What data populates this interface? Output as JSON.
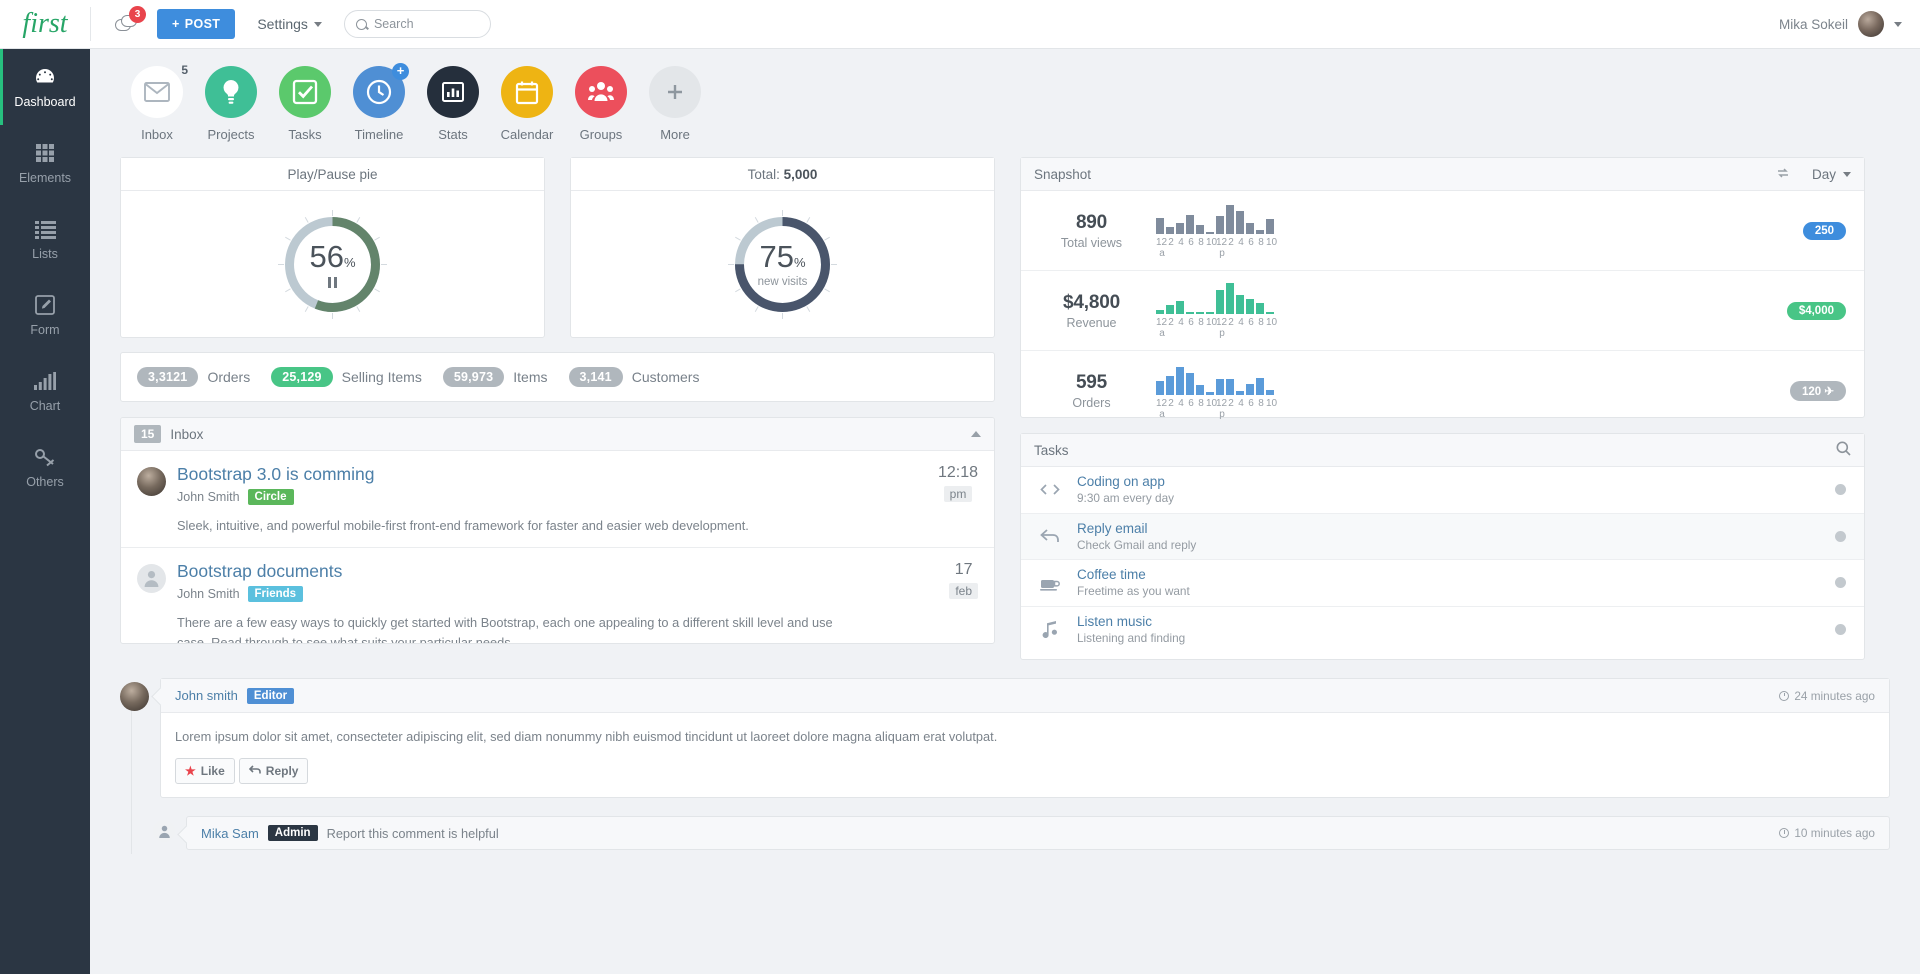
{
  "topbar": {
    "logo": "first",
    "chat_badge": "3",
    "post_label": "POST",
    "settings_label": "Settings",
    "search_placeholder": "Search",
    "search_value": "",
    "user_name": "Mika Sokeil"
  },
  "sidebar": {
    "items": [
      {
        "label": "Dashboard",
        "icon": "dashboard-gauge-icon",
        "active": true
      },
      {
        "label": "Elements",
        "icon": "grid-icon",
        "active": false
      },
      {
        "label": "Lists",
        "icon": "list-icon",
        "active": false
      },
      {
        "label": "Form",
        "icon": "pencil-square-icon",
        "active": false
      },
      {
        "label": "Chart",
        "icon": "bar-chart-icon",
        "active": false
      },
      {
        "label": "Others",
        "icon": "link-icon",
        "active": false
      }
    ]
  },
  "quick_icons": [
    {
      "label": "Inbox",
      "icon": "envelope-icon",
      "color": "#ffffff",
      "badge": "5"
    },
    {
      "label": "Projects",
      "icon": "lightbulb-icon",
      "color": "#3fbf96"
    },
    {
      "label": "Tasks",
      "icon": "check-square-icon",
      "color": "#5bc96c"
    },
    {
      "label": "Timeline",
      "icon": "clock-icon",
      "color": "#4f8fd4",
      "plus": "+"
    },
    {
      "label": "Stats",
      "icon": "chart-bars-icon",
      "color": "#252f3c"
    },
    {
      "label": "Calendar",
      "icon": "calendar-icon",
      "color": "#eeb413"
    },
    {
      "label": "Groups",
      "icon": "users-icon",
      "color": "#ec4f5c"
    },
    {
      "label": "More",
      "icon": "plus-icon",
      "color": "#e3e6e9"
    }
  ],
  "cards": {
    "playpause": {
      "title": "Play/Pause pie",
      "value": "56",
      "unit": "%",
      "icon": "pause-icon"
    },
    "total": {
      "title_prefix": "Total:",
      "title_value": "5,000",
      "value": "75",
      "unit": "%",
      "sublabel": "new visits"
    }
  },
  "stats_strip": [
    {
      "value": "3,3121",
      "label": "Orders",
      "color": "#b0b7bd"
    },
    {
      "value": "25,129",
      "label": "Selling Items",
      "color": "#48c586"
    },
    {
      "value": "59,973",
      "label": "Items",
      "color": "#b0b7bd"
    },
    {
      "value": "3,141",
      "label": "Customers",
      "color": "#b0b7bd"
    }
  ],
  "snapshot": {
    "title": "Snapshot",
    "refresh_icon": "refresh-icon",
    "range_label": "Day",
    "rows": [
      {
        "value": "890",
        "label": "Total views",
        "badge": "250",
        "badge_color": "#3e8ddd",
        "badge_icon": ""
      },
      {
        "value": "$4,800",
        "label": "Revenue",
        "badge": "$4,000",
        "badge_color": "#48c586",
        "badge_icon": ""
      },
      {
        "value": "595",
        "label": "Orders",
        "badge": "120",
        "badge_color": "#b0b7bd",
        "badge_icon": "✈"
      }
    ]
  },
  "chart_data": [
    {
      "type": "bar",
      "title": "Total views",
      "categories": [
        "12a",
        "2",
        "4",
        "6",
        "8",
        "10",
        "12p",
        "2",
        "4",
        "6",
        "8",
        "10"
      ],
      "values": [
        16,
        7,
        11,
        19,
        9,
        2,
        18,
        29,
        23,
        11,
        4,
        15
      ],
      "color": "#7f8b9c",
      "ylim": [
        0,
        32
      ],
      "xlabel": "",
      "ylabel": ""
    },
    {
      "type": "bar",
      "title": "Revenue",
      "categories": [
        "12a",
        "2",
        "4",
        "6",
        "8",
        "10",
        "12p",
        "2",
        "4",
        "6",
        "8",
        "10"
      ],
      "values": [
        4,
        9,
        13,
        2,
        2,
        2,
        24,
        31,
        19,
        15,
        11,
        2
      ],
      "color": "#3fbf96",
      "ylim": [
        0,
        32
      ],
      "xlabel": "",
      "ylabel": ""
    },
    {
      "type": "bar",
      "title": "Orders",
      "categories": [
        "12a",
        "2",
        "4",
        "6",
        "8",
        "10",
        "12p",
        "2",
        "4",
        "6",
        "8",
        "10"
      ],
      "values": [
        14,
        19,
        28,
        22,
        10,
        3,
        16,
        16,
        4,
        11,
        17,
        5
      ],
      "color": "#5b9bd9",
      "ylim": [
        0,
        32
      ],
      "xlabel": "",
      "ylabel": ""
    }
  ],
  "inbox": {
    "title": "Inbox",
    "count": "15",
    "messages": [
      {
        "title": "Bootstrap 3.0 is comming",
        "author": "John Smith",
        "tag": "Circle",
        "tag_color": "#5bb75b",
        "text": "Sleek, intuitive, and powerful mobile-first front-end framework for faster and easier web development.",
        "date_main": "12:18",
        "date_sub": "pm",
        "avatar": "photo"
      },
      {
        "title": "Bootstrap documents",
        "author": "John Smith",
        "tag": "Friends",
        "tag_color": "#5bc0de",
        "text": "There are a few easy ways to quickly get started with Bootstrap, each one appealing to a different skill level and use case. Read through to see what suits your particular needs.",
        "date_main": "17",
        "date_sub": "feb",
        "avatar": "placeholder"
      }
    ]
  },
  "tasks": {
    "title": "Tasks",
    "search_icon": "search-icon",
    "items": [
      {
        "title": "Coding on app",
        "sub": "9:30 am every day",
        "icon": "code-icon"
      },
      {
        "title": "Reply email",
        "sub": "Check Gmail and reply",
        "icon": "reply-icon"
      },
      {
        "title": "Coffee time",
        "sub": "Freetime as you want",
        "icon": "coffee-icon"
      },
      {
        "title": "Listen music",
        "sub": "Listening and finding",
        "icon": "music-icon"
      }
    ]
  },
  "comments": [
    {
      "name": "John smith",
      "tag": "Editor",
      "tag_color": "#4f8fd4",
      "time": "24 minutes ago",
      "body": "Lorem ipsum dolor sit amet, consecteter adipiscing elit, sed diam nonummy nibh euismod tincidunt ut laoreet dolore magna aliquam erat volutpat.",
      "like_label": "Like",
      "reply_label": "Reply"
    },
    {
      "name": "Mika Sam",
      "tag": "Admin",
      "tag_color": "#2b3643",
      "time": "10 minutes ago",
      "body": "Report this comment is helpful"
    }
  ]
}
